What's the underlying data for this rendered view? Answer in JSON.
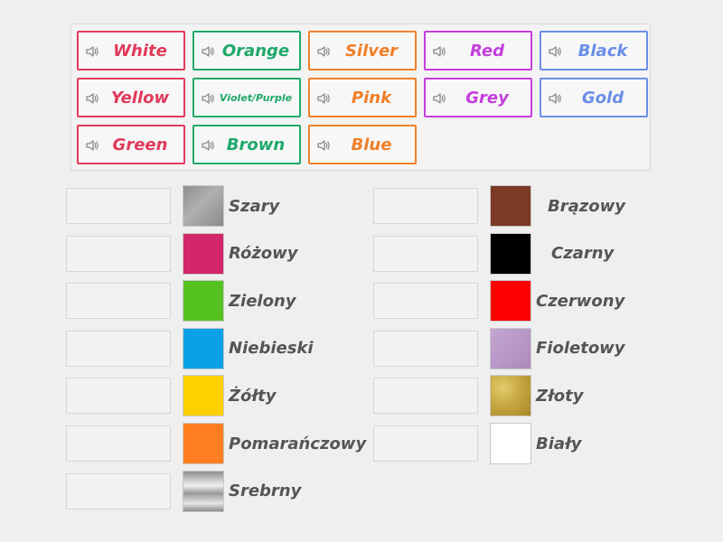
{
  "word_bank": [
    {
      "label": "White",
      "color": "#e03a5a",
      "small": false
    },
    {
      "label": "Orange",
      "color": "#1fa86a",
      "small": false
    },
    {
      "label": "Silver",
      "color": "#f07f28",
      "small": false
    },
    {
      "label": "Red",
      "color": "#c43ddb",
      "small": false
    },
    {
      "label": "Black",
      "color": "#6a8ee8",
      "small": false
    },
    {
      "label": "Yellow",
      "color": "#e03a5a",
      "small": false
    },
    {
      "label": "Violet/Purple",
      "color": "#1fa86a",
      "small": true
    },
    {
      "label": "Pink",
      "color": "#f07f28",
      "small": false
    },
    {
      "label": "Grey",
      "color": "#c43ddb",
      "small": false
    },
    {
      "label": "Gold",
      "color": "#6a8ee8",
      "small": false
    },
    {
      "label": "Green",
      "color": "#e03a5a",
      "small": false
    },
    {
      "label": "Brown",
      "color": "#1fa86a",
      "small": false
    },
    {
      "label": "Blue",
      "color": "#f07f28",
      "small": false
    }
  ],
  "left_rows": [
    {
      "name": "Szary",
      "swatch": "#9a9a9a",
      "texture": "grey"
    },
    {
      "name": "Różowy",
      "swatch": "#d4266a",
      "texture": "solid"
    },
    {
      "name": "Zielony",
      "swatch": "#55c221",
      "texture": "solid"
    },
    {
      "name": "Niebieski",
      "swatch": "#0aa2e6",
      "texture": "solid"
    },
    {
      "name": "Żółty",
      "swatch": "#ffd000",
      "texture": "solid"
    },
    {
      "name": "Pomarańczowy",
      "swatch": "#ff7e20",
      "texture": "solid"
    },
    {
      "name": "Srebrny",
      "swatch": "#b8b8b8",
      "texture": "silver"
    }
  ],
  "right_rows": [
    {
      "name": "Brązowy",
      "swatch": "#7a3a24",
      "texture": "solid"
    },
    {
      "name": "Czarny",
      "swatch": "#000000",
      "texture": "solid"
    },
    {
      "name": "Czerwony",
      "swatch": "#ff0000",
      "texture": "solid"
    },
    {
      "name": "Fioletowy",
      "swatch": "#b794c4",
      "texture": "violet"
    },
    {
      "name": "Złoty",
      "swatch": "#c9ad4a",
      "texture": "gold"
    },
    {
      "name": "Biały",
      "swatch": "#ffffff",
      "texture": "solid"
    }
  ],
  "icons": {
    "speaker": "speaker-icon"
  }
}
